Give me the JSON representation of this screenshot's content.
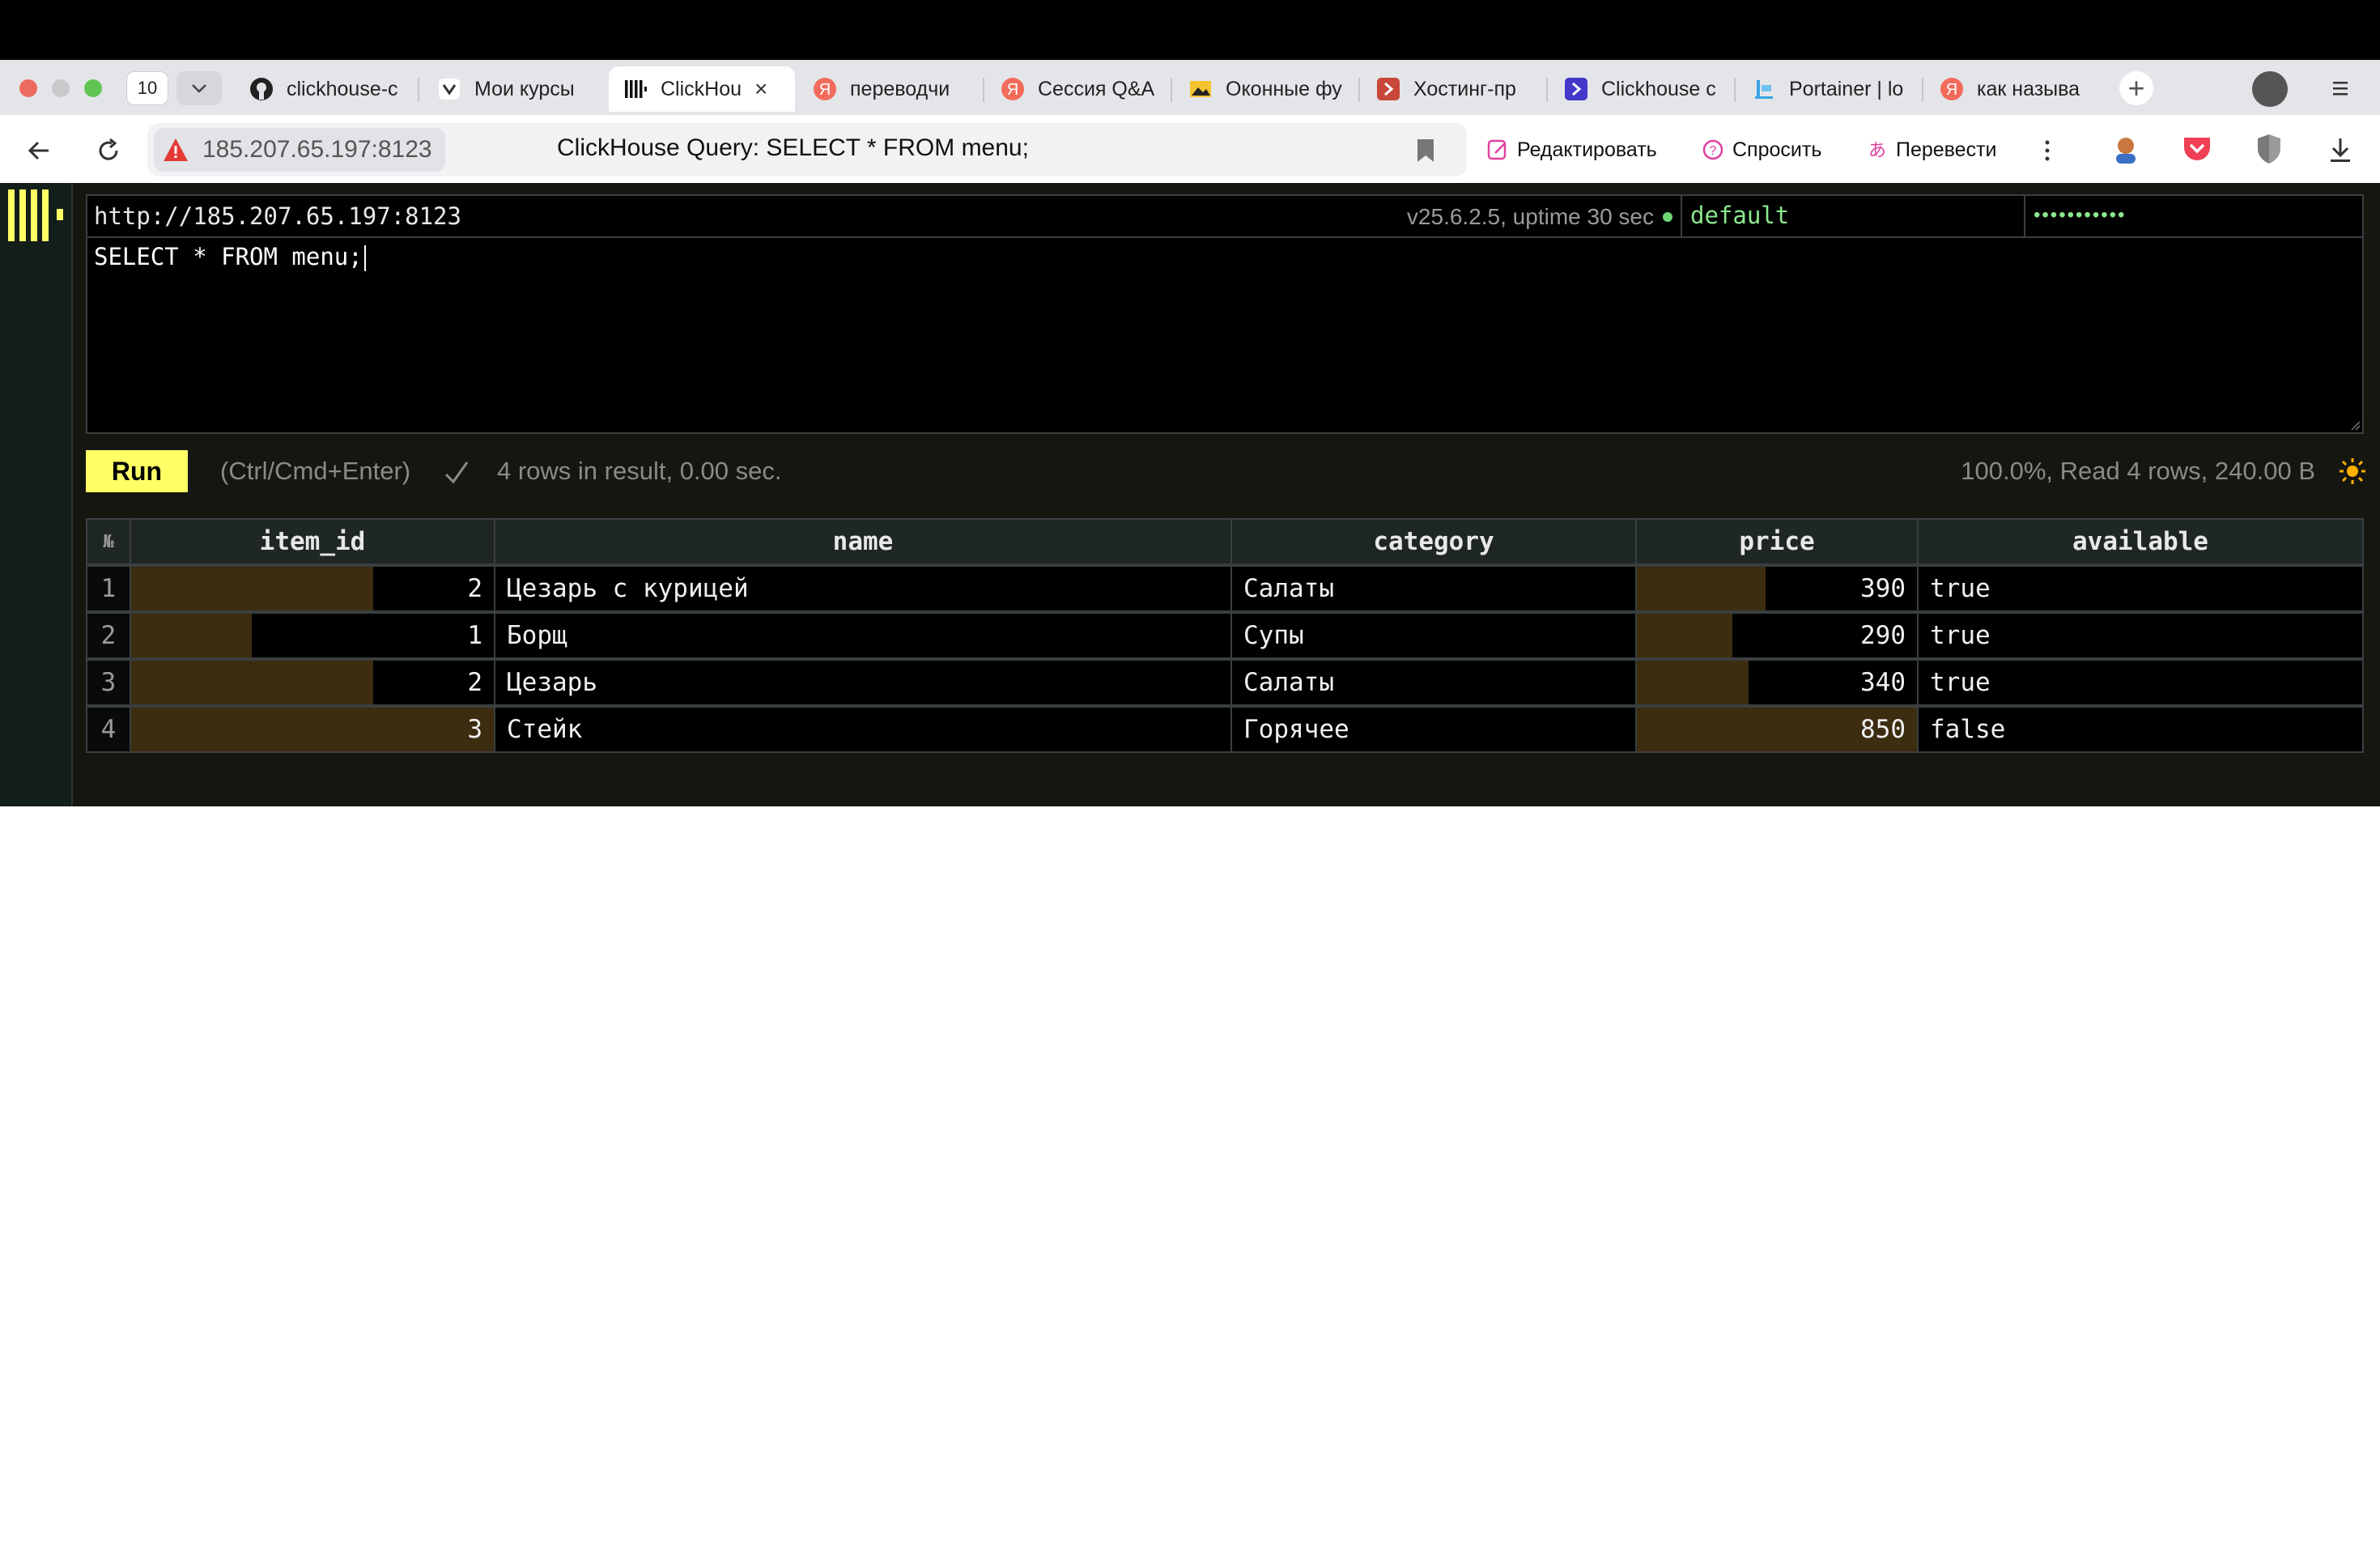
{
  "browser": {
    "tab_count": "10",
    "tabs": [
      {
        "label": "clickhouse-c",
        "icon": "github-icon"
      },
      {
        "label": "Мои курсы",
        "icon": "course-icon"
      },
      {
        "label": "ClickHou",
        "icon": "clickhouse-icon",
        "active": true
      },
      {
        "label": "переводчи",
        "icon": "yandex-icon"
      },
      {
        "label": "Сессия Q&A",
        "icon": "yandex-icon"
      },
      {
        "label": "Оконные фу",
        "icon": "image-icon"
      },
      {
        "label": "Хостинг-пр",
        "icon": "hosting-icon"
      },
      {
        "label": "Clickhouse c",
        "icon": "arrow-icon"
      },
      {
        "label": "Portainer | lo",
        "icon": "portainer-icon"
      },
      {
        "label": "как называ",
        "icon": "yandex-icon"
      }
    ],
    "address_host": "185.207.65.197:8123",
    "page_title": "ClickHouse Query: SELECT * FROM menu;",
    "actions": {
      "edit": "Редактировать",
      "ask": "Спросить",
      "translate": "Перевести"
    }
  },
  "app": {
    "server_url": "http://185.207.65.197:8123",
    "server_status": "v25.6.2.5, uptime 30 sec",
    "user": "default",
    "password_mask": "•••••••••••",
    "query": "SELECT * FROM menu;",
    "run_label": "Run",
    "run_hint": "(Ctrl/Cmd+Enter)",
    "result_summary": "4 rows in result, 0.00 sec.",
    "progress": "100.0%, Read 4 rows, 240.00 B",
    "colors": {
      "accent": "#ffff66",
      "ok": "#6dd672",
      "bar": "#3c2c10"
    }
  },
  "results": {
    "row_number_header": "№",
    "columns": [
      "item_id",
      "name",
      "category",
      "price",
      "available"
    ],
    "rows": [
      {
        "n": "1",
        "item_id": "2",
        "name": "Цезарь с курицей",
        "category": "Салаты",
        "price": "390",
        "available": "true",
        "item_id_frac": 0.667,
        "price_frac": 0.459
      },
      {
        "n": "2",
        "item_id": "1",
        "name": "Борщ",
        "category": "Супы",
        "price": "290",
        "available": "true",
        "item_id_frac": 0.333,
        "price_frac": 0.341
      },
      {
        "n": "3",
        "item_id": "2",
        "name": "Цезарь",
        "category": "Салаты",
        "price": "340",
        "available": "true",
        "item_id_frac": 0.667,
        "price_frac": 0.4
      },
      {
        "n": "4",
        "item_id": "3",
        "name": "Стейк",
        "category": "Горячее",
        "price": "850",
        "available": "false",
        "item_id_frac": 1.0,
        "price_frac": 1.0
      }
    ]
  }
}
